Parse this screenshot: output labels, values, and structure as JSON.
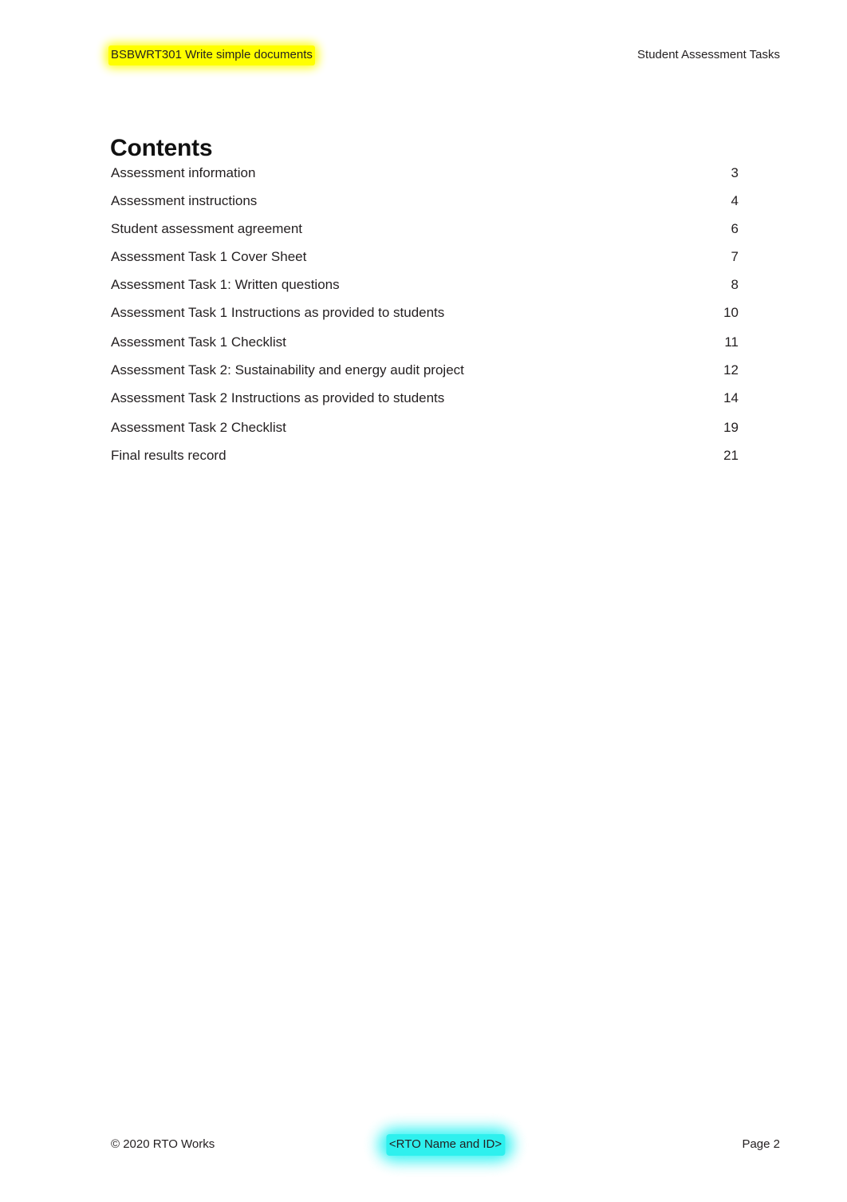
{
  "header": {
    "left_text": "BSBWRT301 Write simple documents",
    "left_highlight_color": "#ffff00",
    "right_text": "Student Assessment Tasks"
  },
  "page_title": "Contents",
  "toc": {
    "entries": [
      {
        "label": "Assessment information",
        "page": "3"
      },
      {
        "label": "Assessment instructions",
        "page": "4"
      },
      {
        "label": "Student assessment agreement",
        "page": "6"
      },
      {
        "label": "Assessment Task 1 Cover Sheet",
        "page": "7"
      },
      {
        "label": "Assessment Task 1: Written questions",
        "page": "8"
      },
      {
        "label": "Assessment Task 1 Instructions as provided to students",
        "page": "10"
      },
      {
        "label": "Assessment Task 1 Checklist",
        "page": "11"
      },
      {
        "label": "Assessment Task 2: Sustainability and energy audit project",
        "page": "12"
      },
      {
        "label": "Assessment Task 2 Instructions as provided to students",
        "page": "14"
      },
      {
        "label": "Assessment Task 2 Checklist",
        "page": "19"
      },
      {
        "label": "Final results record",
        "page": "21"
      }
    ]
  },
  "footer": {
    "left_text": "© 2020 RTO Works",
    "center_text": "<RTO Name and ID>",
    "center_highlight_color": "#2ef0ee",
    "right_text": "Page 2"
  }
}
